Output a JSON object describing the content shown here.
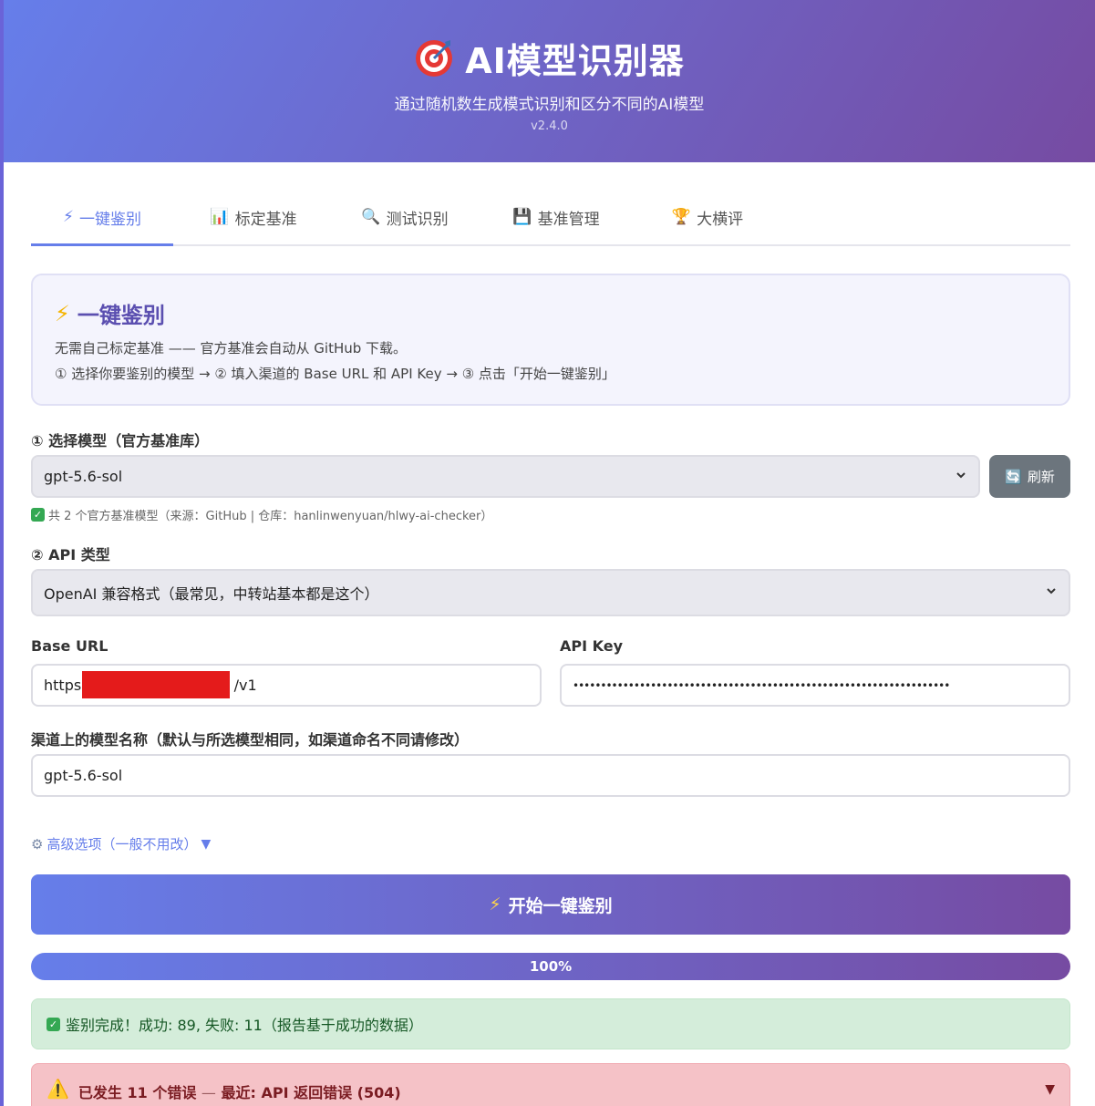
{
  "header": {
    "title": "AI模型识别器",
    "subtitle": "通过随机数生成模式识别和区分不同的AI模型",
    "version": "v2.4.0"
  },
  "tabs": [
    {
      "icon": "⚡",
      "label": "一键鉴别",
      "active": true
    },
    {
      "icon": "📊",
      "label": "标定基准",
      "active": false
    },
    {
      "icon": "🔍",
      "label": "测试识别",
      "active": false
    },
    {
      "icon": "💾",
      "label": "基准管理",
      "active": false
    },
    {
      "icon": "🏆",
      "label": "大横评",
      "active": false
    }
  ],
  "info": {
    "title": "一键鉴别",
    "line1": "无需自己标定基准 —— 官方基准会自动从 GitHub 下载。",
    "line2": "① 选择你要鉴别的模型 → ② 填入渠道的 Base URL 和 API Key → ③ 点击「开始一键鉴别」"
  },
  "form": {
    "model_label": "① 选择模型（官方基准库）",
    "model_value": "gpt-5.6-sol",
    "refresh_label": "刷新",
    "model_hint": "共 2 个官方基准模型（来源：GitHub | 仓库：hanlinwenyuan/hlwy-ai-checker）",
    "api_type_label": "② API 类型",
    "api_type_value": "OpenAI 兼容格式（最常见，中转站基本都是这个）",
    "base_url_label": "Base URL",
    "base_url_prefix": "https:",
    "base_url_suffix": "/v1",
    "api_key_label": "API Key",
    "api_key_value": "••••••••••••••••••••••••••••••••••••••••••••••••••••••••••••••••••••",
    "channel_model_label": "渠道上的模型名称（默认与所选模型相同，如渠道命名不同请修改）",
    "channel_model_value": "gpt-5.6-sol",
    "advanced_label": "高级选项（一般不用改）"
  },
  "start_button": "开始一键鉴别",
  "progress": {
    "percent": 100,
    "label": "100%"
  },
  "success_message": "鉴别完成！成功: 89, 失败: 11（报告基于成功的数据）",
  "error": {
    "head": "已发生 11 个错误",
    "separator": "—",
    "detail": "最近: API 返回错误 (504)"
  },
  "colors": {
    "accent": "#667eea",
    "accent2": "#764ba2",
    "success_bg": "#d4edda",
    "error_bg": "#f5c2c7"
  }
}
